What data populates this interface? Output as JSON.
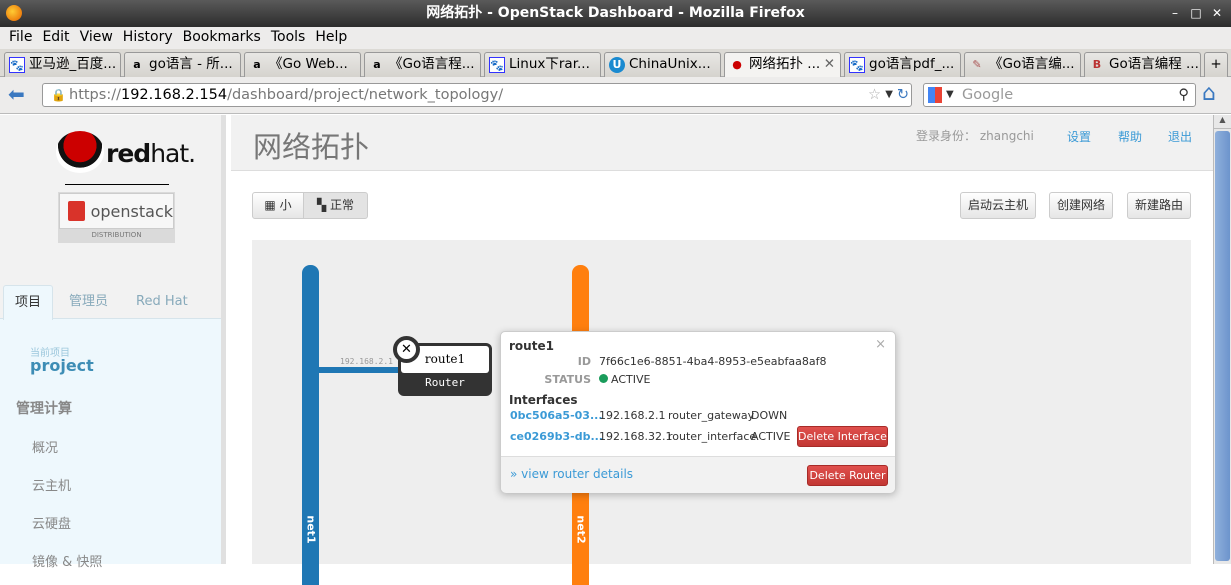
{
  "window": {
    "title": "网络拓扑 - OpenStack Dashboard - Mozilla Firefox"
  },
  "menu": [
    "File",
    "Edit",
    "View",
    "History",
    "Bookmarks",
    "Tools",
    "Help"
  ],
  "tabs": [
    {
      "label": "亚马逊_百度...",
      "icon": "paw"
    },
    {
      "label": "go语言 - 所...",
      "icon": "a"
    },
    {
      "label": "《Go Web...",
      "icon": "a"
    },
    {
      "label": "《Go语言程...",
      "icon": "a"
    },
    {
      "label": "Linux下rar...",
      "icon": "paw"
    },
    {
      "label": "ChinaUnix...",
      "icon": "U"
    },
    {
      "label": "网络拓扑 ...",
      "icon": "redhat"
    },
    {
      "label": "go语言pdf_...",
      "icon": "paw"
    },
    {
      "label": "《Go语言编...",
      "icon": "book"
    },
    {
      "label": "Go语言编程 ...",
      "icon": "J"
    }
  ],
  "nav": {
    "url_prefix": "https://",
    "url_host": "192.168.2.154",
    "url_path": "/dashboard/project/network_topology/",
    "search_placeholder": "Google"
  },
  "sidebar": {
    "logo_text": "redhat.",
    "openstack_text": "openstack",
    "distribution": "DISTRIBUTION",
    "tabs": [
      "项目",
      "管理员",
      "Red Hat"
    ],
    "current_project_label": "当前项目",
    "current_project": "project",
    "section": "管理计算",
    "items": [
      "概况",
      "云主机",
      "云硬盘",
      "镜像 & 快照"
    ]
  },
  "header": {
    "title": "网络拓扑",
    "login_label": "登录身份：",
    "user": "zhangchi",
    "settings": "设置",
    "help": "帮助",
    "logout": "退出"
  },
  "toolbar": {
    "small": "小",
    "normal": "正常",
    "launch": "启动云主机",
    "create_network": "创建网络",
    "create_router": "新建路由"
  },
  "topology": {
    "networks": [
      {
        "name": "net1",
        "color": "#1f77b4"
      },
      {
        "name": "net2",
        "color": "#ff7f0e"
      }
    ],
    "link_label": "192.168.2.1",
    "router": {
      "name": "route1",
      "type": "Router"
    }
  },
  "popup": {
    "title": "route1",
    "id_label": "ID",
    "id": "7f66c1e6-8851-4ba4-8953-e5eabfaa8af8",
    "status_label": "STATUS",
    "status": "ACTIVE",
    "status_color": "#1a9c5b",
    "interfaces_label": "Interfaces",
    "interfaces": [
      {
        "id": "0bc506a5-03...",
        "ip": "192.168.2.1",
        "type": "router_gateway",
        "status": "DOWN"
      },
      {
        "id": "ce0269b3-db...",
        "ip": "192.168.32.1",
        "type": "router_interface",
        "status": "ACTIVE",
        "action": "Delete Interface"
      }
    ],
    "details_link": "» view router details",
    "delete_router": "Delete Router",
    "close": "×"
  }
}
